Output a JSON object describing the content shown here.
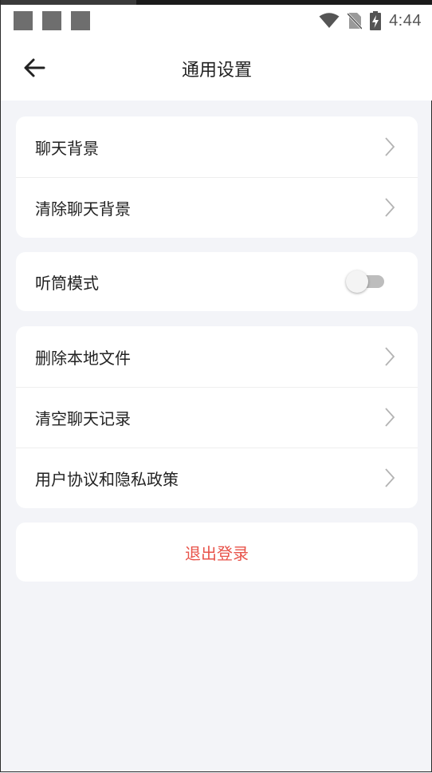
{
  "status_bar": {
    "time": "4:44",
    "icons": [
      "notification-square-icon",
      "notification-square-icon",
      "notification-square-icon",
      "wifi-icon",
      "no-sim-icon",
      "battery-charging-icon"
    ]
  },
  "header": {
    "title": "通用设置",
    "back_icon": "arrow-left-icon"
  },
  "groups": [
    {
      "items": [
        {
          "label": "聊天背景"
        },
        {
          "label": "清除聊天背景"
        }
      ]
    },
    {
      "items": [
        {
          "label": "听筒模式",
          "toggle": false
        }
      ]
    },
    {
      "items": [
        {
          "label": "删除本地文件"
        },
        {
          "label": "清空聊天记录"
        },
        {
          "label": "用户协议和隐私政策"
        }
      ]
    }
  ],
  "logout": {
    "label": "退出登录"
  },
  "colors": {
    "accent_red": "#e8534a",
    "background": "#f3f4f8",
    "card": "#ffffff",
    "toggle_off_track": "#bdbdbd"
  }
}
